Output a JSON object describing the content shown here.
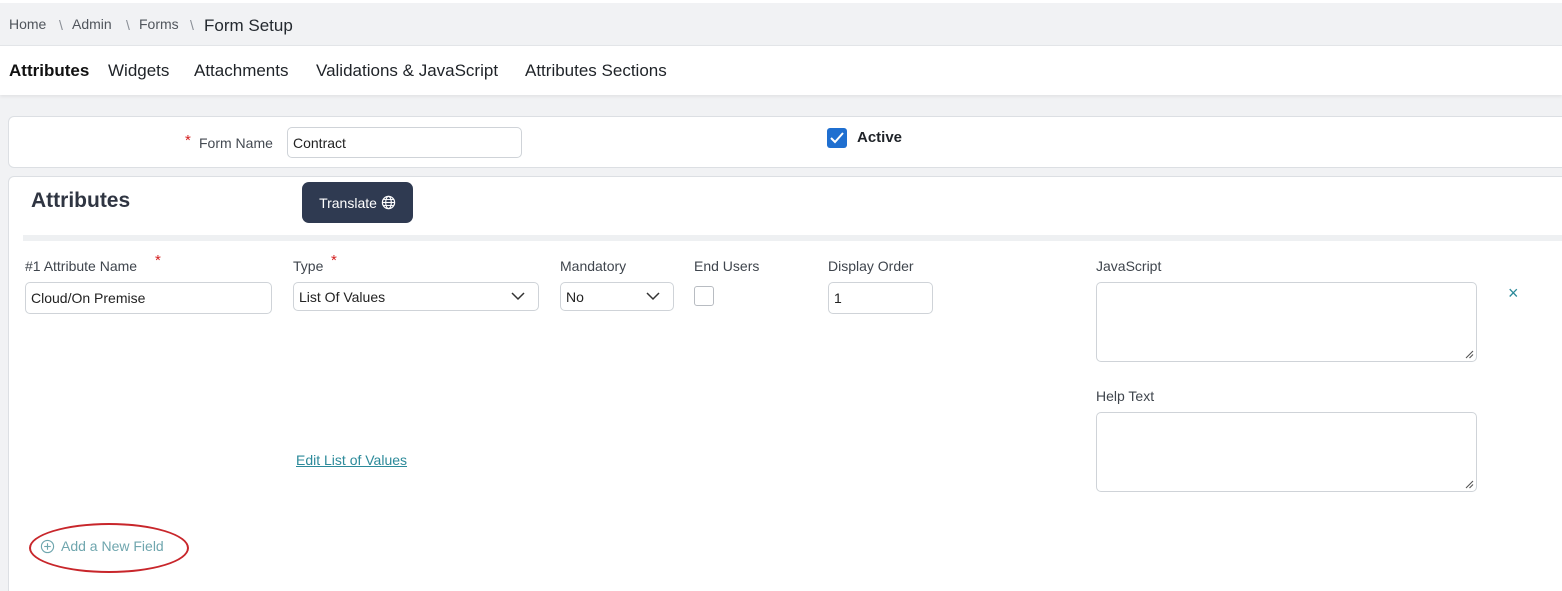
{
  "breadcrumb": {
    "items": [
      "Home",
      "Admin",
      "Forms"
    ],
    "separator": "\\",
    "current": "Form Setup"
  },
  "tabs": [
    {
      "label": "Attributes",
      "active": true
    },
    {
      "label": "Widgets",
      "active": false
    },
    {
      "label": "Attachments",
      "active": false
    },
    {
      "label": "Validations & JavaScript",
      "active": false
    },
    {
      "label": "Attributes Sections",
      "active": false
    }
  ],
  "form": {
    "required_mark": "*",
    "name_label": "Form Name",
    "name_value": "Contract",
    "active_label": "Active",
    "active_checked": true
  },
  "attributes": {
    "title": "Attributes",
    "translate_label": "Translate",
    "row": {
      "name_label": "#1 Attribute Name",
      "name_value": "Cloud/On Premise",
      "type_label": "Type",
      "type_value": "List Of Values",
      "mandatory_label": "Mandatory",
      "mandatory_value": "No",
      "end_users_label": "End Users",
      "end_users_checked": false,
      "display_order_label": "Display Order",
      "display_order_value": "1",
      "javascript_label": "JavaScript",
      "javascript_value": "",
      "help_text_label": "Help Text",
      "help_text_value": "",
      "remove_symbol": "×",
      "edit_lov_label": "Edit List of Values"
    },
    "add_field_label": "Add a New Field"
  },
  "colors": {
    "primary_dark": "#2f3a51",
    "accent_link": "#2c8a9a",
    "required": "#d42020",
    "checkbox": "#1f6fd0",
    "highlight": "#c8262b"
  }
}
